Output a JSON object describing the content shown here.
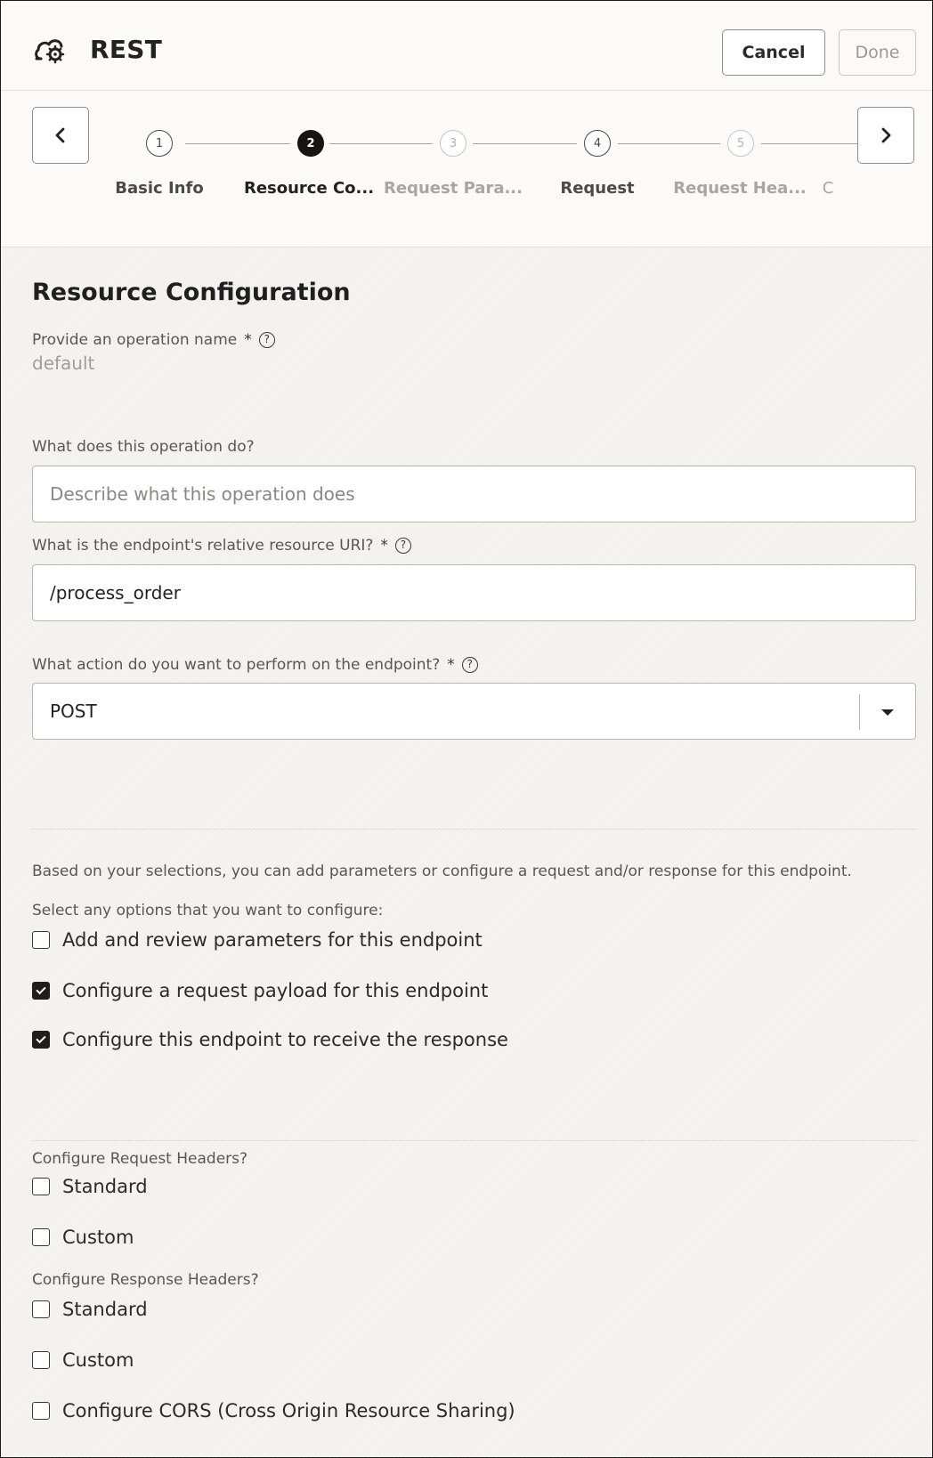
{
  "header": {
    "title": "REST",
    "cancel_label": "Cancel",
    "done_label": "Done"
  },
  "train": {
    "steps": [
      {
        "number": "1",
        "label": "Basic Info",
        "state": "done"
      },
      {
        "number": "2",
        "label": "Resource Co...",
        "state": "current"
      },
      {
        "number": "3",
        "label": "Request Para...",
        "state": "disabled"
      },
      {
        "number": "4",
        "label": "Request",
        "state": "todo"
      },
      {
        "number": "5",
        "label": "Request Hea...",
        "state": "disabled"
      },
      {
        "number": "",
        "label": "C",
        "state": "disabled"
      }
    ],
    "prev_icon": "chevron-left-icon",
    "next_icon": "chevron-right-icon"
  },
  "form": {
    "title": "Resource Configuration",
    "operation_name_label": "Provide an operation name",
    "operation_name_value": "default",
    "required_mark": "*",
    "help_glyph": "?",
    "description_label": "What does this operation do?",
    "description_placeholder": "Describe what this operation does",
    "uri_label": "What is the endpoint's relative resource URI?",
    "uri_value": "/process_order",
    "action_label": "What action do you want to perform on the endpoint?",
    "action_value": "POST",
    "info_text": "Based on your selections, you can add parameters or configure a request and/or response for this endpoint.",
    "select_text": "Select any options that you want to configure:",
    "options": [
      {
        "label": "Add and review parameters for this endpoint",
        "checked": false
      },
      {
        "label": "Configure a request payload for this endpoint",
        "checked": true
      },
      {
        "label": "Configure this endpoint to receive the response",
        "checked": true
      }
    ],
    "request_headers_label": "Configure Request Headers?",
    "request_headers": [
      {
        "label": "Standard",
        "checked": false
      },
      {
        "label": "Custom",
        "checked": false
      }
    ],
    "response_headers_label": "Configure Response Headers?",
    "response_headers": [
      {
        "label": "Standard",
        "checked": false
      },
      {
        "label": "Custom",
        "checked": false
      }
    ],
    "cors_label": "Configure CORS (Cross Origin Resource Sharing)",
    "cors_checked": false
  }
}
